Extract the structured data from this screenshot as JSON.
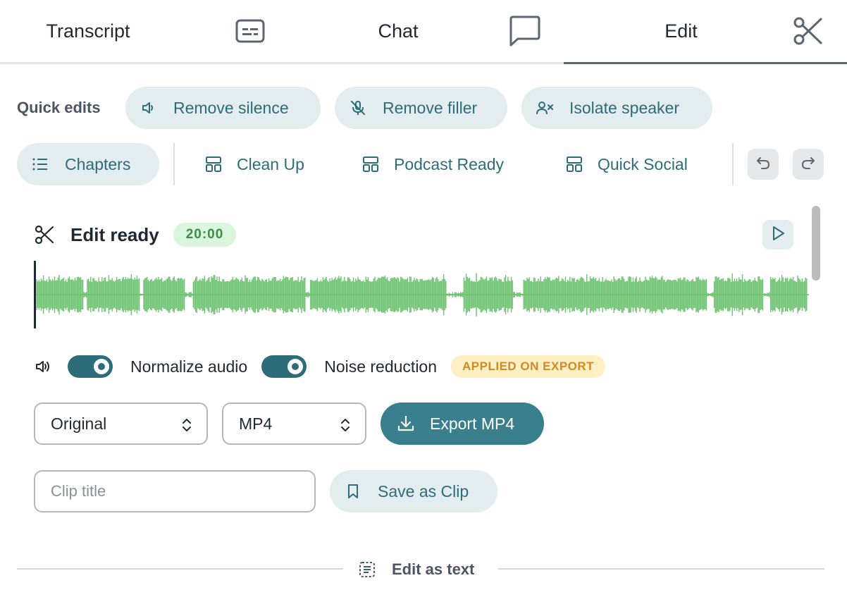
{
  "tabs": [
    {
      "label": "Transcript",
      "icon": "transcript-icon"
    },
    {
      "label": "Chat",
      "icon": "chat-bubble-icon"
    },
    {
      "label": "Edit",
      "icon": "scissors-icon",
      "active": true
    }
  ],
  "quick_edits": {
    "label": "Quick edits",
    "items": [
      {
        "label": "Remove silence",
        "icon": "speaker-icon"
      },
      {
        "label": "Remove filler",
        "icon": "mic-off-icon"
      },
      {
        "label": "Isolate speaker",
        "icon": "user-x-icon"
      }
    ]
  },
  "presets": {
    "chapters": {
      "label": "Chapters",
      "icon": "list-icon"
    },
    "items": [
      {
        "label": "Clean Up",
        "icon": "layout-icon"
      },
      {
        "label": "Podcast Ready",
        "icon": "layout-icon"
      },
      {
        "label": "Quick Social",
        "icon": "layout-icon"
      }
    ],
    "undo_icon": "undo-icon",
    "redo_icon": "redo-icon"
  },
  "editor": {
    "title": "Edit ready",
    "duration": "20:00",
    "play_icon": "play-icon",
    "waveform_color": "#6cc26f"
  },
  "audio": {
    "volume_icon": "volume-icon",
    "normalize_label": "Normalize audio",
    "normalize_on": true,
    "noise_label": "Noise reduction",
    "noise_on": true,
    "export_badge": "APPLIED ON EXPORT"
  },
  "export": {
    "resolution": "Original",
    "format": "MP4",
    "button_label": "Export MP4"
  },
  "clip": {
    "placeholder": "Clip title",
    "value": "",
    "save_label": "Save as Clip"
  },
  "footer": {
    "edit_as_text": "Edit as text"
  },
  "colors": {
    "accent": "#2d6c79",
    "pill_bg": "#e3ecee",
    "badge_green_bg": "#d9f5dc",
    "badge_yellow_bg": "#fcf0c4"
  }
}
